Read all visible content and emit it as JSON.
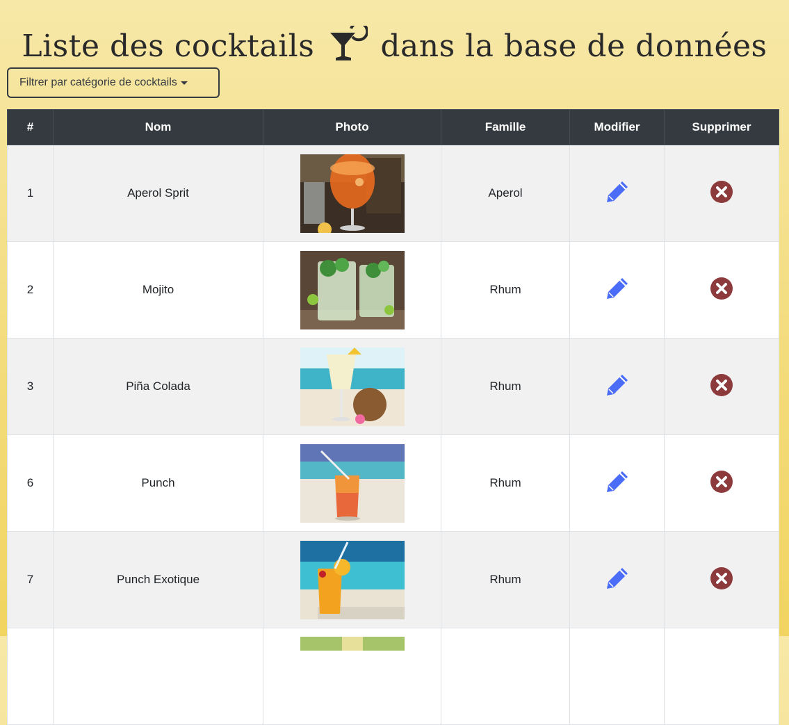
{
  "page": {
    "title_part1": "Liste des cocktails",
    "title_part2": "dans la base de données"
  },
  "filter": {
    "label": "Filtrer par catégorie de cocktails"
  },
  "table": {
    "columns": [
      "#",
      "Nom",
      "Photo",
      "Famille",
      "Modifier",
      "Supprimer"
    ],
    "rows": [
      {
        "id": "1",
        "name": "Aperol Sprit",
        "family": "Aperol",
        "photo": "aperol-spritz-photo"
      },
      {
        "id": "2",
        "name": "Mojito",
        "family": "Rhum",
        "photo": "mojito-photo"
      },
      {
        "id": "3",
        "name": "Piña Colada",
        "family": "Rhum",
        "photo": "pina-colada-photo"
      },
      {
        "id": "6",
        "name": "Punch",
        "family": "Rhum",
        "photo": "punch-photo"
      },
      {
        "id": "7",
        "name": "Punch Exotique",
        "family": "Rhum",
        "photo": "punch-exotique-photo"
      }
    ]
  },
  "icons": {
    "edit": "pencil-icon",
    "delete": "close-circle-icon",
    "title": "cocktail-glass-icon"
  },
  "colors": {
    "header_bg": "#343a40",
    "edit_icon": "#4a6cf7",
    "delete_icon": "#8c3a3c",
    "background": "#f3db79"
  }
}
